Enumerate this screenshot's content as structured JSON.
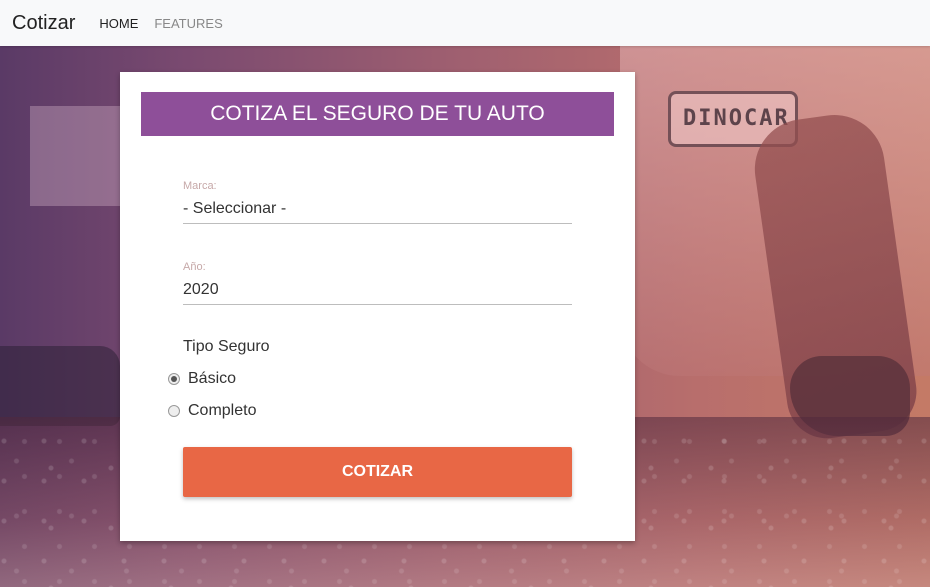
{
  "navbar": {
    "brand": "Cotizar",
    "links": [
      {
        "label": "HOME",
        "active": true
      },
      {
        "label": "FEATURES",
        "active": false
      }
    ]
  },
  "background": {
    "plate_text": "DINOCAR"
  },
  "form": {
    "title": "COTIZA EL SEGURO DE TU AUTO",
    "marca": {
      "label": "Marca:",
      "value": "- Seleccionar -"
    },
    "anio": {
      "label": "Año:",
      "value": "2020"
    },
    "tipo_seguro": {
      "label": "Tipo Seguro",
      "options": [
        {
          "label": "Básico",
          "checked": true
        },
        {
          "label": "Completo",
          "checked": false
        }
      ]
    },
    "submit_label": "COTIZAR"
  },
  "colors": {
    "header_purple": "#8e4f99",
    "button_orange": "#e86745",
    "navbar_bg": "#f8f9fa"
  }
}
